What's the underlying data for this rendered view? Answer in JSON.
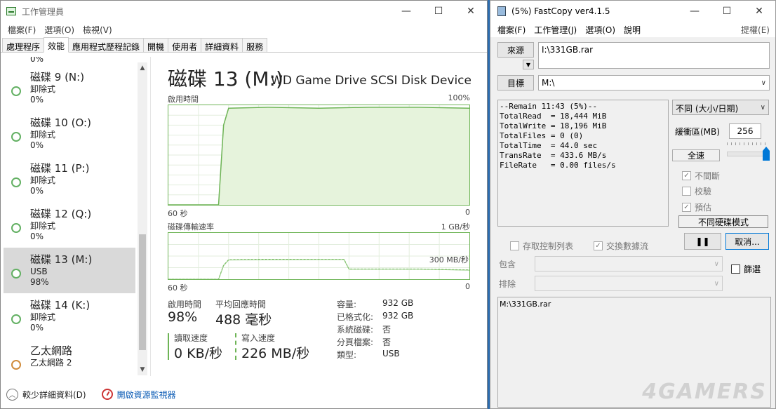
{
  "taskmgr": {
    "title": "工作管理員",
    "menu": [
      "檔案(F)",
      "選項(O)",
      "檢視(V)"
    ],
    "tabs": [
      "處理程序",
      "效能",
      "應用程式歷程記錄",
      "開機",
      "使用者",
      "詳細資料",
      "服務"
    ],
    "active_tab": "效能",
    "sidebar_top_partial": "0%",
    "sidebar": [
      {
        "name": "磁碟 9 (N:)",
        "sub": "卸除式",
        "value": "0%"
      },
      {
        "name": "磁碟 10 (O:)",
        "sub": "卸除式",
        "value": "0%"
      },
      {
        "name": "磁碟 11 (P:)",
        "sub": "卸除式",
        "value": "0%"
      },
      {
        "name": "磁碟 12 (Q:)",
        "sub": "卸除式",
        "value": "0%"
      },
      {
        "name": "磁碟 13 (M:)",
        "sub": "USB",
        "value": "98%"
      },
      {
        "name": "磁碟 14 (K:)",
        "sub": "卸除式",
        "value": "0%"
      },
      {
        "name": "乙太網路",
        "sub": "乙太網路 2",
        "value": ""
      }
    ],
    "disk_title": "磁碟 13 (M:)",
    "disk_model": "WD Game Drive SCSI Disk Device",
    "graph1": {
      "label": "啟用時間",
      "max": "100%",
      "time": "60 秒",
      "min": "0"
    },
    "graph2": {
      "label": "磁碟傳輸速率",
      "max": "1 GB/秒",
      "mid": "300 MB/秒",
      "time": "60 秒",
      "min": "0"
    },
    "stats": {
      "active_time_label": "啟用時間",
      "active_time": "98%",
      "avg_resp_label": "平均回應時間",
      "avg_resp": "488 毫秒",
      "read_label": "讀取速度",
      "read": "0 KB/秒",
      "write_label": "寫入速度",
      "write": "226 MB/秒"
    },
    "props": [
      {
        "k": "容量:",
        "v": "932 GB"
      },
      {
        "k": "已格式化:",
        "v": "932 GB"
      },
      {
        "k": "系統磁碟:",
        "v": "否"
      },
      {
        "k": "分頁檔案:",
        "v": "否"
      },
      {
        "k": "類型:",
        "v": "USB"
      }
    ],
    "footer": {
      "less": "較少詳細資料(D)",
      "monitor": "開啟資源監視器"
    }
  },
  "fastcopy": {
    "title": "(5%) FastCopy ver4.1.5",
    "menu": [
      "檔案(F)",
      "工作管理(J)",
      "選項(O)",
      "說明"
    ],
    "menu_right": "提權(E)",
    "source_btn": "來源",
    "source_value": "I:\\331GB.rar",
    "dest_btn": "目標",
    "dest_value": "M:\\",
    "log_lines": [
      "--Remain 11:43 (5%)--",
      "TotalRead  = 18,444 MiB",
      "TotalWrite = 18,196 MiB",
      "TotalFiles = 0 (0)",
      "TotalTime  = 44.0 sec",
      "TransRate  = 433.6 MB/s",
      "FileRate   = 0.00 files/s"
    ],
    "mode": "不同 (大小/日期)",
    "buffer_label": "緩衝區(MB)",
    "buffer_value": "256",
    "speed_label": "全速",
    "speed_level": 1.0,
    "opt_nonstop": "不間斷",
    "opt_verify": "校驗",
    "opt_estimate": "預估",
    "diff_disk": "不同硬碟模式",
    "save_acl": "存取控制列表",
    "alt_stream": "交換數據流",
    "pause_btn": "❚❚",
    "cancel_btn": "取消...",
    "include_label": "包含",
    "exclude_label": "排除",
    "filter_label": "篩選",
    "file_list": "M:\\331GB.rar"
  },
  "watermark": "4GAMERS",
  "chart_data": [
    {
      "type": "area",
      "title": "啟用時間",
      "xlabel": "60 秒",
      "ylim": [
        0,
        100
      ],
      "x": [
        60,
        50,
        49,
        48,
        40,
        30,
        20,
        10,
        0
      ],
      "series": [
        {
          "values": [
            0,
            0,
            80,
            97,
            98,
            97,
            98,
            98,
            97
          ]
        }
      ]
    },
    {
      "type": "area",
      "title": "磁碟傳輸速率",
      "xlabel": "60 秒",
      "ylim": [
        0,
        1000
      ],
      "x": [
        60,
        50,
        49,
        48,
        40,
        30,
        25,
        24,
        10,
        0
      ],
      "series": [
        {
          "values": [
            0,
            0,
            300,
            420,
            430,
            430,
            430,
            220,
            220,
            200
          ]
        },
        {
          "values": [
            0,
            0,
            290,
            415,
            420,
            425,
            425,
            215,
            215,
            195
          ]
        }
      ]
    }
  ]
}
